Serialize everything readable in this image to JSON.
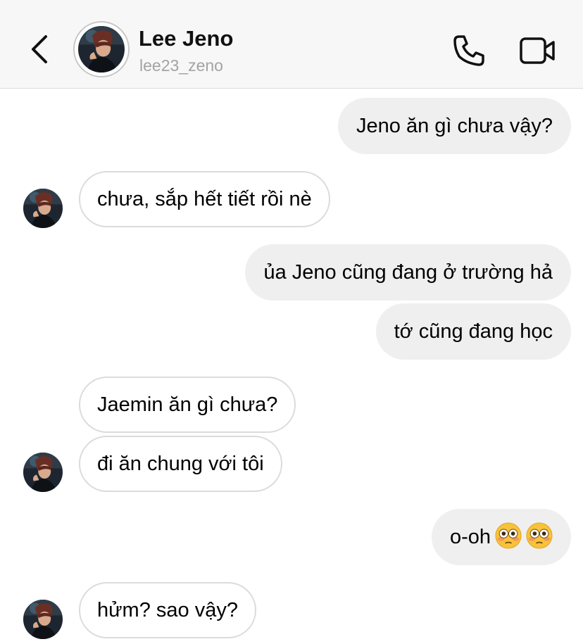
{
  "header": {
    "name": "Lee Jeno",
    "username": "lee23_zeno"
  },
  "messages": [
    {
      "dir": "out",
      "text": "Jeno ăn gì chưa vậy?"
    },
    {
      "dir": "in",
      "text": "chưa, sắp hết tiết rồi nè"
    },
    {
      "dir": "out",
      "text": "ủa Jeno cũng đang ở trường hả"
    },
    {
      "dir": "out",
      "text": "tớ cũng đang học"
    },
    {
      "dir": "in",
      "text": "Jaemin ăn gì chưa?"
    },
    {
      "dir": "in",
      "text": "đi ăn chung với tôi"
    },
    {
      "dir": "out",
      "text": "o-oh",
      "emoji": [
        "flushed-face",
        "flushed-face"
      ]
    },
    {
      "dir": "in",
      "text": "hửm? sao vậy?"
    }
  ],
  "icons": {
    "back": "chevron-left-icon",
    "call": "phone-icon",
    "video": "video-camera-icon"
  }
}
